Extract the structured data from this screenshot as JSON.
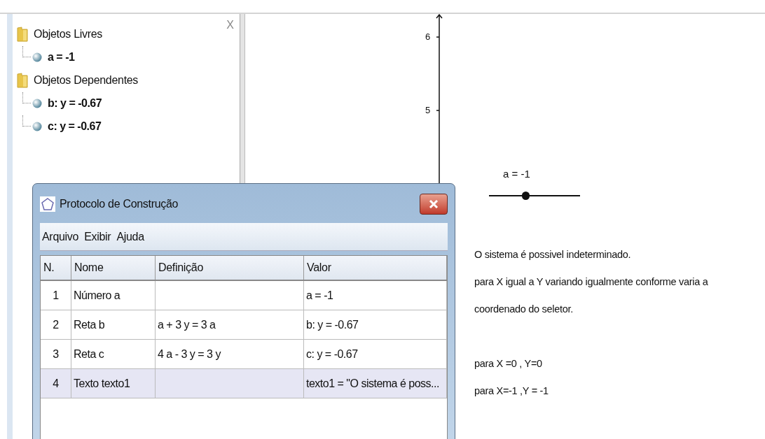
{
  "algebra_view": {
    "close_glyph": "X",
    "tree": [
      {
        "label": "Objetos Livres",
        "children": [
          {
            "label": "a = -1"
          }
        ]
      },
      {
        "label": "Objetos Dependentes",
        "children": [
          {
            "label": "b: y = -0.67"
          },
          {
            "label": "c: y = -0.67"
          }
        ]
      }
    ]
  },
  "graphics_view": {
    "y_axis_labels": [
      "6",
      "5"
    ],
    "slider": {
      "label": "a = -1",
      "level": 0.4
    },
    "text_blocks": [
      [
        "O sistema é possivel indeterminado.",
        "para X igual a Y variando igualmente conforme varia a",
        "coordenado do seletor."
      ],
      [
        "para X =0 , Y=0",
        "para X=-1 ,Y = -1"
      ]
    ]
  },
  "dialog": {
    "title": "Protocolo de Construção",
    "menu": [
      "Arquivo",
      "Exibir",
      "Ajuda"
    ],
    "table": {
      "columns": [
        "N.",
        "Nome",
        "Definição",
        "Valor"
      ],
      "rows": [
        {
          "cells": [
            "1",
            "Número a",
            "",
            "a = -1"
          ],
          "selected": false
        },
        {
          "cells": [
            "2",
            "Reta b",
            "a + 3 y = 3 a",
            "b: y = -0.67"
          ],
          "selected": false
        },
        {
          "cells": [
            "3",
            "Reta c",
            "4 a - 3 y = 3 y",
            "c: y = -0.67"
          ],
          "selected": false
        },
        {
          "cells": [
            "4",
            "Texto texto1",
            "",
            "texto1 = \"O sistema é poss..."
          ],
          "selected": true
        }
      ]
    }
  }
}
